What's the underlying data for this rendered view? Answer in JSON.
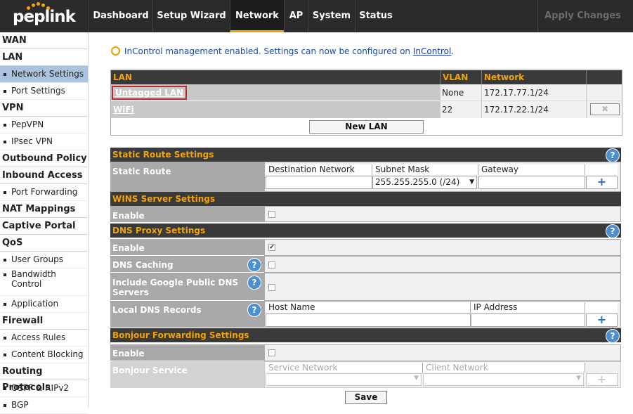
{
  "header": {
    "logo_text": "peplink",
    "tabs": [
      {
        "label": "Dashboard"
      },
      {
        "label": "Setup Wizard"
      },
      {
        "label": "Network"
      },
      {
        "label": "AP"
      },
      {
        "label": "System"
      },
      {
        "label": "Status"
      }
    ],
    "apply_label": "Apply Changes"
  },
  "sidebar": {
    "wan": "WAN",
    "lan": "LAN",
    "network_settings": "Network Settings",
    "port_settings": "Port Settings",
    "vpn": "VPN",
    "pepvpn": "PepVPN",
    "ipsec_vpn": "IPsec VPN",
    "outbound_policy": "Outbound Policy",
    "inbound_access": "Inbound Access",
    "port_forwarding": "Port Forwarding",
    "nat_mappings": "NAT Mappings",
    "captive_portal": "Captive Portal",
    "qos": "QoS",
    "user_groups": "User Groups",
    "bandwidth_control": "Bandwidth Control",
    "application": "Application",
    "firewall": "Firewall",
    "access_rules": "Access Rules",
    "content_blocking": "Content Blocking",
    "routing_protocols": "Routing Protocols",
    "ospf": "OSPF & RIPv2",
    "bgp": "BGP"
  },
  "notice": {
    "text": "InControl management enabled. Settings can now be configured on ",
    "link": "InControl",
    "end": "."
  },
  "lan_table": {
    "col_lan": "LAN",
    "col_vlan": "VLAN",
    "col_network": "Network",
    "rows": [
      {
        "name": "Untagged LAN",
        "vlan": "None",
        "network": "172.17.77.1/24"
      },
      {
        "name": "WiFi",
        "vlan": "22",
        "network": "172.17.22.1/24"
      }
    ],
    "new_lan_label": "New LAN",
    "delete_glyph": "✖"
  },
  "static_route": {
    "title": "Static Route Settings",
    "label": "Static Route",
    "col_dest": "Destination Network",
    "col_mask": "Subnet Mask",
    "col_gateway": "Gateway",
    "mask_value": "255.255.255.0 (/24)",
    "add_glyph": "+"
  },
  "wins": {
    "title": "WINS Server Settings",
    "enable_label": "Enable"
  },
  "dns_proxy": {
    "title": "DNS Proxy Settings",
    "enable_label": "Enable",
    "enable_check": "✔",
    "caching_label": "DNS Caching",
    "google_label": "Include Google Public DNS Servers",
    "local_records_label": "Local DNS Records",
    "col_host": "Host Name",
    "col_ip": "IP Address",
    "add_glyph": "+"
  },
  "bonjour": {
    "title": "Bonjour Forwarding Settings",
    "enable_label": "Enable",
    "service_label": "Bonjour Service",
    "col_service": "Service Network",
    "col_client": "Client Network",
    "add_glyph": "+"
  },
  "help_glyph": "?",
  "save_label": "Save",
  "colors": {
    "accent": "#f3a400",
    "header_bg": "#2b2b2b",
    "active_nav": "#aac3df",
    "help": "#4d8fd1",
    "highlight": "#c0262d"
  }
}
